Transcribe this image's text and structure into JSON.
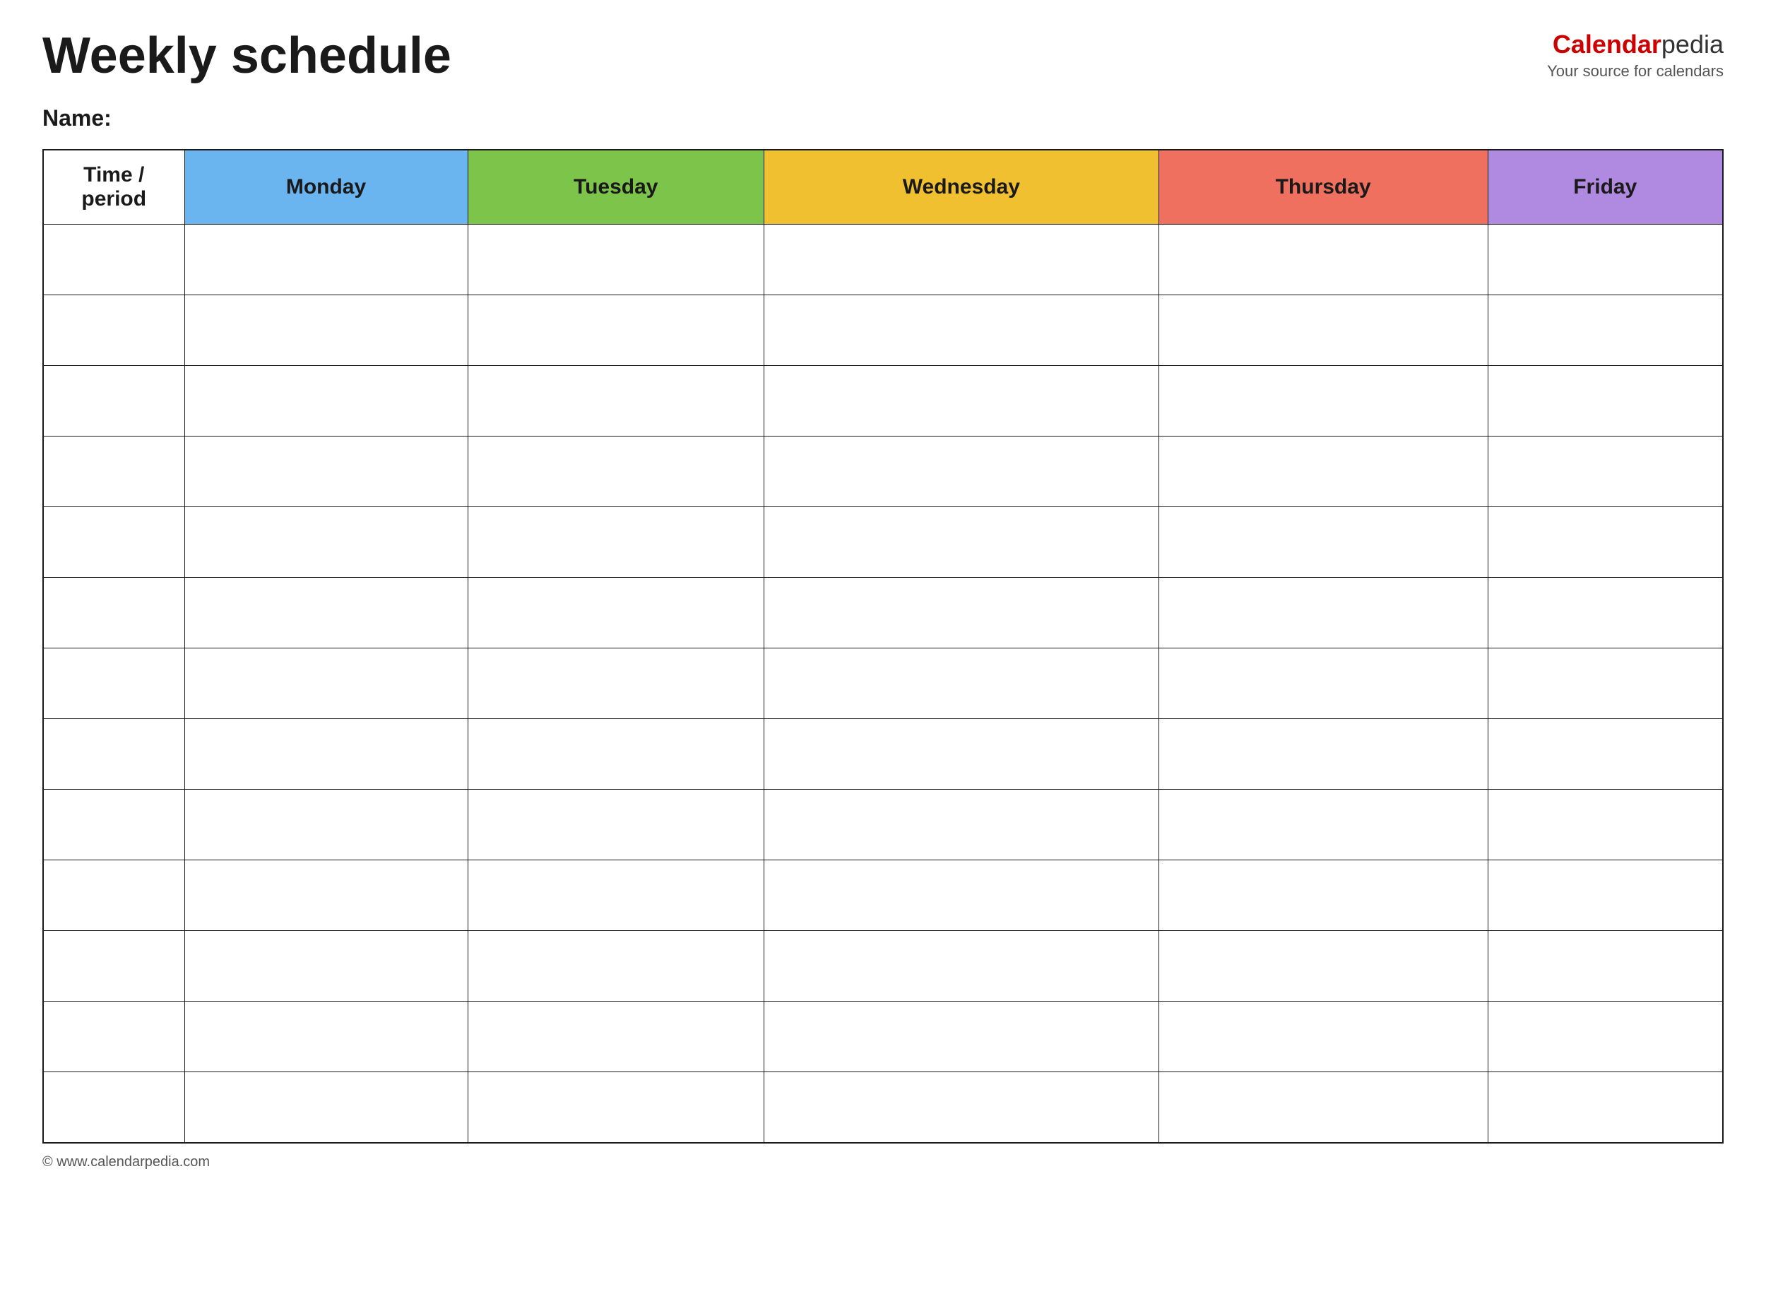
{
  "header": {
    "title": "Weekly schedule",
    "brand_name_regular": "Calendar",
    "brand_name_accent": "pedia",
    "brand_tagline": "Your source for calendars"
  },
  "name_label": "Name:",
  "columns": [
    {
      "id": "time",
      "label": "Time / period",
      "color_class": "col-time"
    },
    {
      "id": "monday",
      "label": "Monday",
      "color_class": "col-monday"
    },
    {
      "id": "tuesday",
      "label": "Tuesday",
      "color_class": "col-tuesday"
    },
    {
      "id": "wednesday",
      "label": "Wednesday",
      "color_class": "col-wednesday"
    },
    {
      "id": "thursday",
      "label": "Thursday",
      "color_class": "col-thursday"
    },
    {
      "id": "friday",
      "label": "Friday",
      "color_class": "col-friday"
    }
  ],
  "row_count": 13,
  "footer": {
    "copyright": "© www.calendarpedia.com"
  }
}
